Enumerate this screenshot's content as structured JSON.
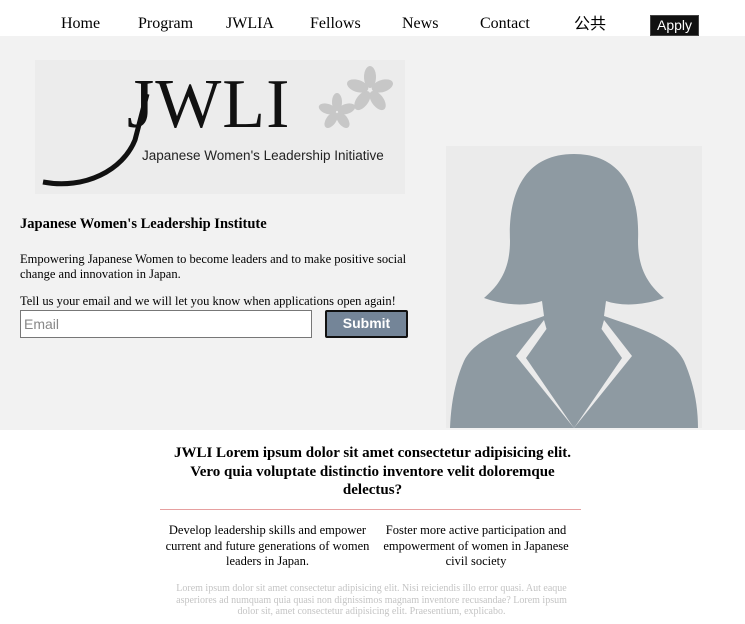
{
  "nav": {
    "items": [
      {
        "label": "Home"
      },
      {
        "label": "Program"
      },
      {
        "label": "JWLIA"
      },
      {
        "label": "Fellows"
      },
      {
        "label": "News"
      },
      {
        "label": "Contact"
      },
      {
        "label": "公共"
      }
    ],
    "apply_label": "Apply"
  },
  "hero": {
    "logo": {
      "wordmark": "JWLI",
      "subtitle": "Japanese Women's Leadership Initiative"
    },
    "institute_title": "Japanese Women's Leadership Institute",
    "tagline": "Empowering Japanese Women to become leaders and to make positive social change and innovation in Japan.",
    "email_prompt": "Tell us your email and we will let you know when applications open again!",
    "email_placeholder": "Email",
    "submit_label": "Submit"
  },
  "content": {
    "headline": "JWLI Lorem ipsum dolor sit amet consectetur adipisicing elit. Vero quia voluptate distinctio inventore velit doloremque delectus?",
    "col_left": "Develop leadership skills and empower current and future generations of women leaders in Japan.",
    "col_right": "Foster more active participation and empowerment of women in Japanese civil society",
    "faded_text": "Lorem ipsum dolor sit amet consectetur adipisicing elit. Nisi reiciendis illo error quasi. Aut eaque asperiores ad numquam quia quasi non dignissimos magnam inventore recusandae? Lorem ipsum dolor sit, amet consectetur adipisicing elit. Praesentium, explicabo."
  },
  "colors": {
    "hero_bg": "#f2f2f2",
    "submit_bg": "#748598",
    "avatar": "#8e9aa2",
    "divider": "#e6a0a0"
  }
}
